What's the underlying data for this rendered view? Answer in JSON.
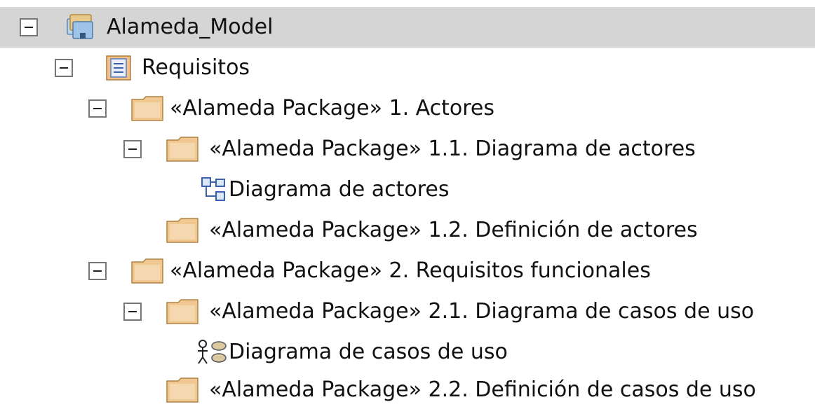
{
  "tree": {
    "root": {
      "label": "Alameda_Model",
      "icon": "model-root-icon"
    },
    "requisitos": {
      "label": "Requisitos",
      "icon": "package-diagram-icon"
    },
    "actores": {
      "label": "«Alameda Package» 1. Actores",
      "icon": "folder-icon"
    },
    "diag_actores_pkg": {
      "label": "«Alameda Package» 1.1. Diagrama de actores",
      "icon": "folder-icon"
    },
    "diag_actores": {
      "label": "Diagrama de actores",
      "icon": "class-diagram-icon"
    },
    "def_actores": {
      "label": "«Alameda Package» 1.2. Definición de actores",
      "icon": "folder-icon"
    },
    "req_func": {
      "label": "«Alameda Package» 2. Requisitos funcionales",
      "icon": "folder-icon"
    },
    "diag_casos_pkg": {
      "label": "«Alameda Package» 2.1. Diagrama de casos de uso",
      "icon": "folder-icon"
    },
    "diag_casos": {
      "label": "Diagrama de casos de uso",
      "icon": "use-case-diagram-icon"
    },
    "def_casos": {
      "label": "«Alameda Package» 2.2. Definición de casos de uso",
      "icon": "folder-icon"
    }
  }
}
